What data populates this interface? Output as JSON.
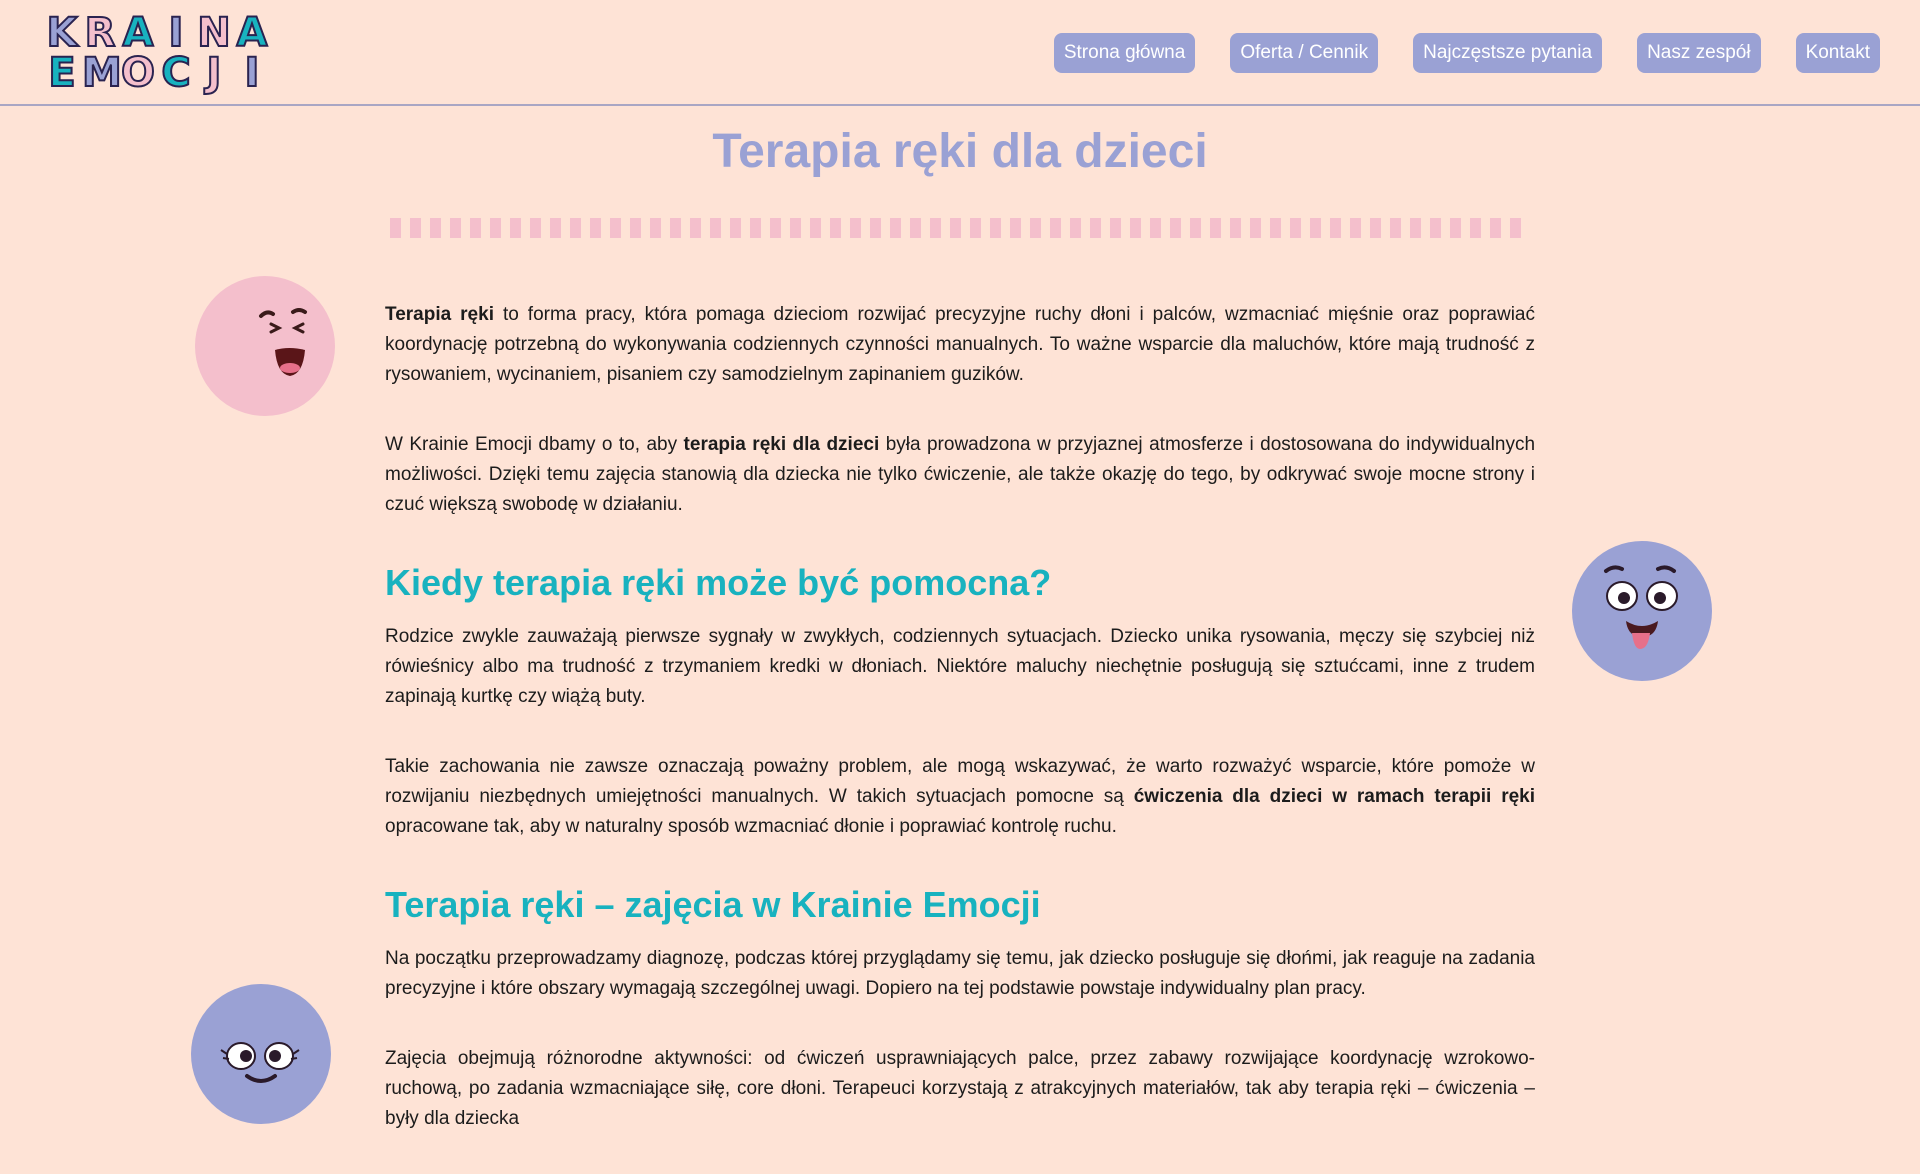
{
  "logo": {
    "row1": [
      "K",
      "R",
      "A",
      "I",
      "N",
      "A"
    ],
    "row2": [
      "E",
      "M",
      "O",
      "C",
      "J",
      "I"
    ],
    "row1_colors": [
      "#9aa1d4",
      "#f4bfcc",
      "#18b2bf",
      "#9aa1d4",
      "#f4bfcc",
      "#18b2bf"
    ],
    "row2_colors": [
      "#18b2bf",
      "#9aa1d4",
      "#f4bfcc",
      "#18b2bf",
      "#f4bfcc",
      "#9aa1d4"
    ]
  },
  "nav": {
    "home": "Strona główna",
    "offer": "Oferta / Cennik",
    "faq": "Najczęstsze pytania",
    "team": "Nasz zespół",
    "contact": "Kontakt"
  },
  "main": {
    "title": "Terapia ręki dla dzieci",
    "p1": {
      "bold": "Terapia ręki",
      "text": " to forma pracy, która pomaga dzieciom rozwijać precyzyjne ruchy dłoni i palców, wzmacniać mięśnie oraz poprawiać koordynację potrzebną do wykonywania codziennych czynności manualnych. To ważne wsparcie dla maluchów, które mają trudność z rysowaniem, wycinaniem, pisaniem czy samodzielnym zapinaniem guzików."
    },
    "p2": {
      "pre": "W Krainie Emocji dbamy o to, aby ",
      "bold": "terapia ręki dla dzieci",
      "post": " była prowadzona w przyjaznej atmosferze i dostosowana do indywidualnych możliwości. Dzięki temu zajęcia stanowią dla dziecka nie tylko ćwiczenie, ale także okazję do tego, by odkrywać swoje mocne strony i czuć większą swobodę w działaniu."
    },
    "h2_1": "Kiedy terapia ręki może być pomocna?",
    "p3": "Rodzice zwykle zauważają pierwsze sygnały w zwykłych, codziennych sytuacjach. Dziecko unika rysowania, męczy się szybciej niż rówieśnicy albo ma trudność z trzymaniem kredki w dłoniach. Niektóre maluchy niechętnie posługują się sztućcami, inne z trudem zapinają kurtkę czy wiążą buty.",
    "p4": {
      "pre": "Takie zachowania nie zawsze oznaczają poważny problem, ale mogą wskazywać, że warto rozważyć wsparcie, które pomoże w rozwijaniu niezbędnych umiejętności manualnych. W takich sytuacjach pomocne są ",
      "bold": "ćwiczenia dla dzieci w ramach terapii ręki",
      "post": " opracowane tak, aby w naturalny sposób wzmacniać dłonie i poprawiać kontrolę ruchu."
    },
    "h2_2": "Terapia ręki – zajęcia w Krainie Emocji",
    "p5": "Na początku przeprowadzamy diagnozę, podczas której przyglądamy się temu, jak dziecko posługuje się dłońmi, jak reaguje na zadania precyzyjne i które obszary wymagają szczególnej uwagi. Dopiero na tej podstawie powstaje indywidualny plan pracy.",
    "p6": "Zajęcia obejmują różnorodne aktywności: od ćwiczeń usprawniających palce, przez zabawy rozwijające koordynację wzrokowo-ruchową, po zadania wzmacniające siłę, core dłoni. Terapeuci korzystają z atrakcyjnych materiałów, tak aby terapia ręki – ćwiczenia – były dla dziecka"
  },
  "colors": {
    "background": "#fee3d6",
    "accent_purple": "#9aa1d4",
    "accent_pink": "#f4bfcc",
    "accent_teal": "#18b2bf"
  }
}
